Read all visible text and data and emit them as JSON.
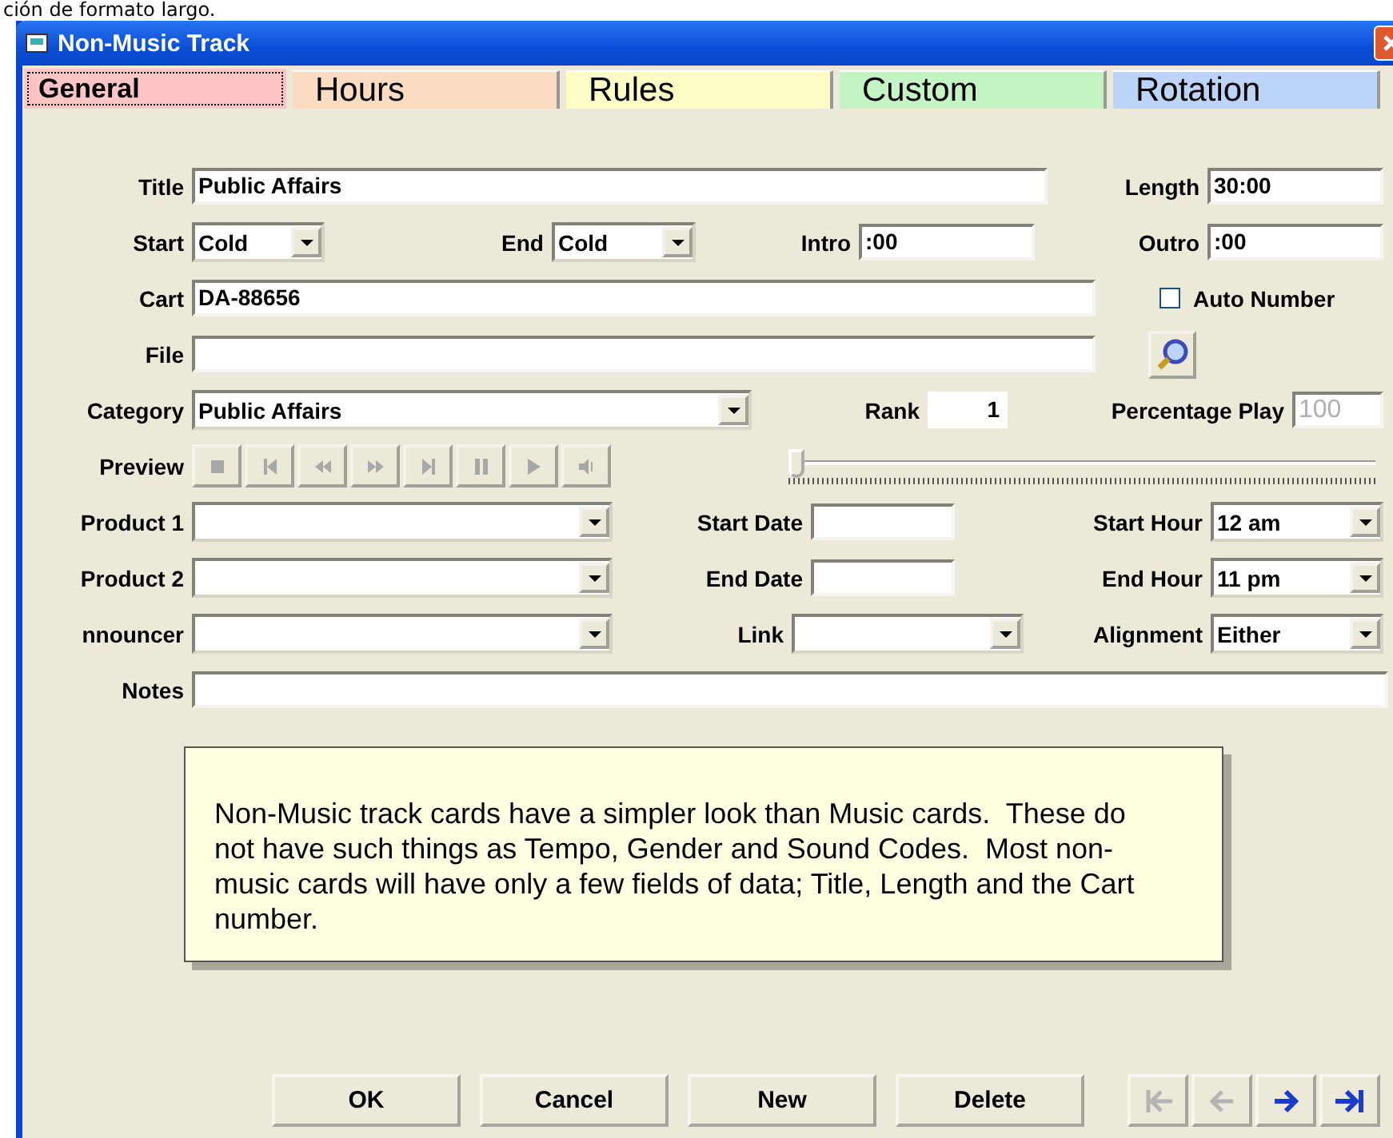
{
  "caption_above": "ción de formato largo.",
  "window": {
    "title": "Non-Music Track"
  },
  "tabs": [
    {
      "label": "General",
      "selected": true,
      "color": "#ffc4c4"
    },
    {
      "label": "Hours",
      "selected": false,
      "color": "#fcdcc0"
    },
    {
      "label": "Rules",
      "selected": false,
      "color": "#fcfcc4"
    },
    {
      "label": "Custom",
      "selected": false,
      "color": "#c4f4c4"
    },
    {
      "label": "Rotation",
      "selected": false,
      "color": "#bcd4f8"
    }
  ],
  "form": {
    "title": {
      "label": "Title",
      "value": "Public Affairs"
    },
    "length": {
      "label": "Length",
      "value": "30:00"
    },
    "start": {
      "label": "Start",
      "value": "Cold"
    },
    "end": {
      "label": "End",
      "value": "Cold"
    },
    "intro": {
      "label": "Intro",
      "value": ":00"
    },
    "outro": {
      "label": "Outro",
      "value": ":00"
    },
    "cart": {
      "label": "Cart",
      "value": "DA-88656"
    },
    "auto_number": {
      "label": "Auto Number",
      "checked": false
    },
    "file": {
      "label": "File"
    },
    "category": {
      "label": "Category",
      "value": "Public Affairs"
    },
    "rank": {
      "label": "Rank",
      "value": "1"
    },
    "percentage_play": {
      "label": "Percentage Play",
      "value": "100",
      "disabled": true
    },
    "preview": {
      "label": "Preview",
      "disabled": true,
      "buttons": [
        {
          "kind": "stop"
        },
        {
          "kind": "first"
        },
        {
          "kind": "rewind"
        },
        {
          "kind": "forward"
        },
        {
          "kind": "last"
        },
        {
          "kind": "pause"
        },
        {
          "kind": "play"
        },
        {
          "kind": "cue"
        }
      ]
    },
    "position_slider": {
      "level": 0
    },
    "product_1": {
      "label": "Product 1"
    },
    "start_date": {
      "label": "Start Date"
    },
    "start_hour": {
      "label": "Start Hour",
      "value": "12 am"
    },
    "product_2": {
      "label": "Product 2"
    },
    "end_date": {
      "label": "End Date"
    },
    "end_hour": {
      "label": "End Hour",
      "value": "11 pm"
    },
    "announcer": {
      "label": "nnouncer"
    },
    "link": {
      "label": "Link"
    },
    "alignment": {
      "label": "Alignment",
      "value": "Either"
    },
    "notes": {
      "label": "Notes"
    }
  },
  "note": "Non-Music track cards have a simpler look than Music cards.  These do not have such things as Tempo, Gender and Sound Codes.  Most non-music cards will have only a few fields of data; Title, Length and the Cart number.",
  "buttons": [
    "OK",
    "Cancel",
    "New",
    "Delete"
  ],
  "navigation": [
    {
      "kind": "first",
      "disabled": true
    },
    {
      "kind": "previous",
      "disabled": true
    },
    {
      "kind": "next",
      "disabled": false
    },
    {
      "kind": "last",
      "disabled": false
    }
  ]
}
